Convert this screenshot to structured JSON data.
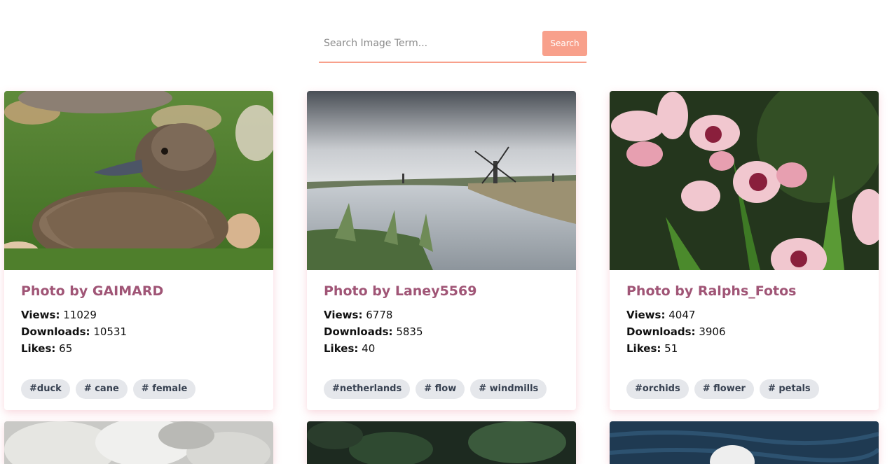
{
  "search": {
    "placeholder": "Search Image Term...",
    "button_label": "Search"
  },
  "cards": [
    {
      "title": "Photo by GAIMARD",
      "views_label": "Views:",
      "views": "11029",
      "downloads_label": "Downloads:",
      "downloads": "10531",
      "likes_label": "Likes:",
      "likes": "65",
      "tags": [
        "#duck",
        "# cane",
        "# female"
      ],
      "image": "duck-photo"
    },
    {
      "title": "Photo by Laney5569",
      "views_label": "Views:",
      "views": "6778",
      "downloads_label": "Downloads:",
      "downloads": "5835",
      "likes_label": "Likes:",
      "likes": "40",
      "tags": [
        "#netherlands",
        "# flow",
        "# windmills"
      ],
      "image": "windmills-photo"
    },
    {
      "title": "Photo by Ralphs_Fotos",
      "views_label": "Views:",
      "views": "4047",
      "downloads_label": "Downloads:",
      "downloads": "3906",
      "likes_label": "Likes:",
      "likes": "51",
      "tags": [
        "#orchids",
        "# flower",
        "# petals"
      ],
      "image": "orchids-photo"
    }
  ],
  "colors": {
    "accent": "#f8a08b",
    "title": "#a05576",
    "tag_bg": "#e5e7eb"
  }
}
